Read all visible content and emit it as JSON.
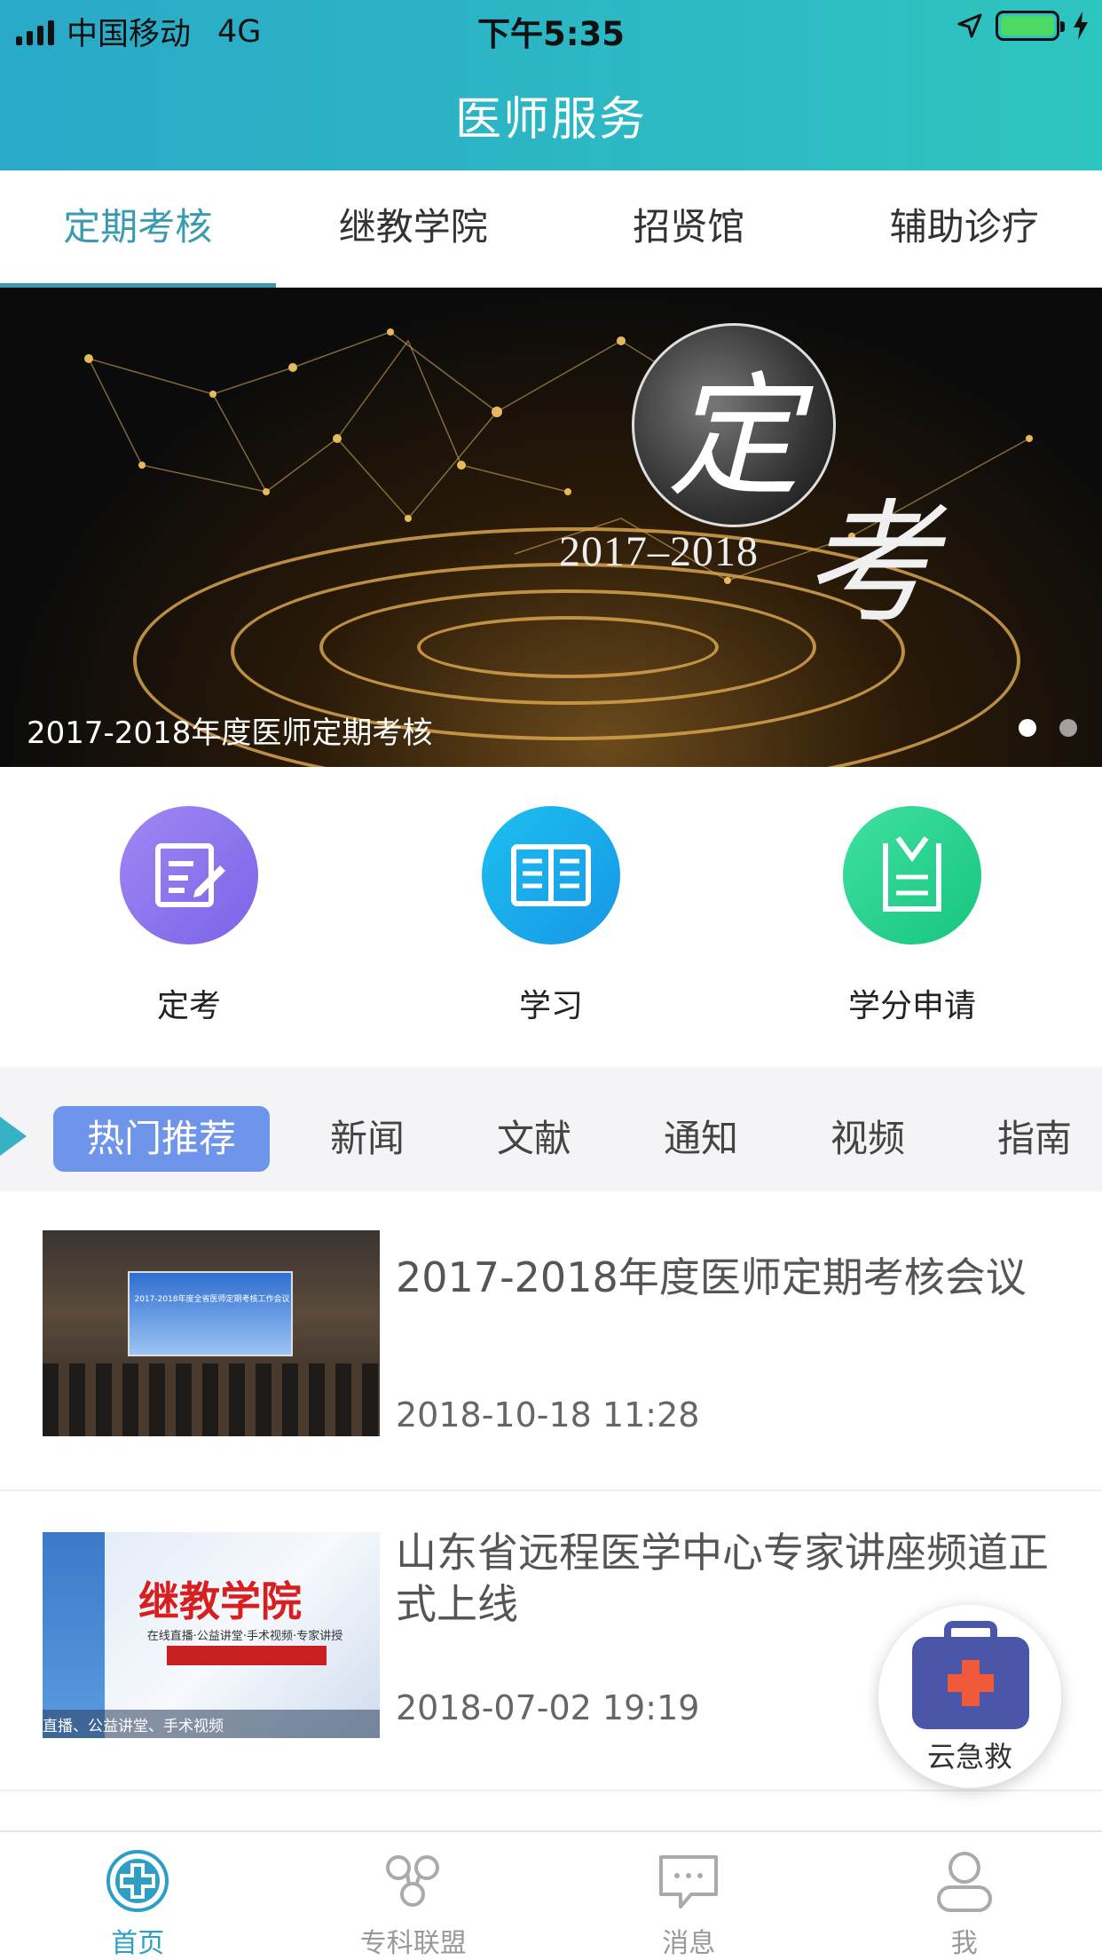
{
  "status_bar": {
    "carrier": "中国移动",
    "network": "4G",
    "time": "下午5:35"
  },
  "header": {
    "title": "医师服务"
  },
  "top_tabs": [
    {
      "label": "定期考核",
      "active": true
    },
    {
      "label": "继教学院",
      "active": false
    },
    {
      "label": "招贤馆",
      "active": false
    },
    {
      "label": "辅助诊疗",
      "active": false
    }
  ],
  "banner": {
    "badge_char": "定",
    "second_char": "考",
    "year": "2017–2018",
    "caption": "2017-2018年度医师定期考核",
    "dots": 2,
    "active_dot": 0
  },
  "quick_actions": [
    {
      "label": "定考",
      "icon": "edit-document-icon",
      "color": "#8a74ee"
    },
    {
      "label": "学习",
      "icon": "open-book-icon",
      "color": "#1aa8ec"
    },
    {
      "label": "学分申请",
      "icon": "checklist-icon",
      "color": "#26d58f"
    }
  ],
  "categories": [
    {
      "label": "热门推荐",
      "active": true
    },
    {
      "label": "新闻",
      "active": false
    },
    {
      "label": "文献",
      "active": false
    },
    {
      "label": "通知",
      "active": false
    },
    {
      "label": "视频",
      "active": false
    },
    {
      "label": "指南",
      "active": false
    }
  ],
  "news": [
    {
      "title": "2017-2018年度医师定期考核会议",
      "date": "2018-10-18 11:28",
      "thumb_text": "2017-2018年度全省医师定期考核工作会议"
    },
    {
      "title": "山东省远程医学中心专家讲座频道正式上线",
      "date": "2018-07-02 19:19",
      "thumb_title": "继教学院",
      "thumb_subtitle": "在线直播·公益讲堂·手术视频·专家讲授",
      "thumb_footer": "直播、公益讲堂、手术视频"
    }
  ],
  "fab": {
    "label": "云急救",
    "icon": "medical-kit-icon"
  },
  "tabbar": [
    {
      "label": "首页",
      "icon": "home-cross-icon",
      "active": true
    },
    {
      "label": "专科联盟",
      "icon": "network-nodes-icon",
      "active": false
    },
    {
      "label": "消息",
      "icon": "message-bubble-icon",
      "active": false
    },
    {
      "label": "我",
      "icon": "user-icon",
      "active": false
    }
  ],
  "colors": {
    "header_start": "#2aa9c9",
    "header_end": "#2ec4bf",
    "active_tab": "#3a9ab0",
    "category_active": "#6f95ea",
    "tabbar_active": "#2d9fc4"
  }
}
